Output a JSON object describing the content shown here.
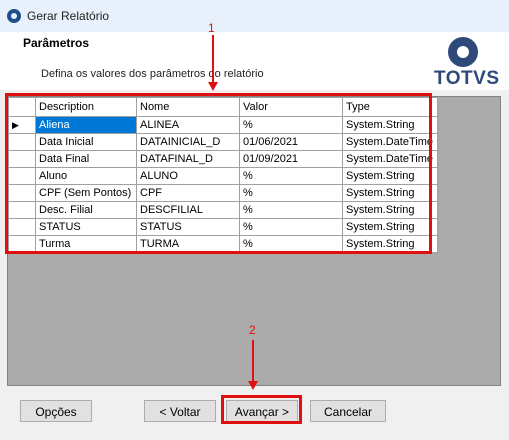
{
  "window": {
    "title": "Gerar Relatório"
  },
  "header": {
    "title": "Parâmetros",
    "description": "Defina os valores dos parâmetros do relatório",
    "logo_text": "TOTVS"
  },
  "grid": {
    "columns": [
      "Description",
      "Nome",
      "Valor",
      "Type"
    ],
    "current_row_marker": "▶",
    "rows": [
      [
        "Aliena",
        "ALINEA",
        "%",
        "System.String"
      ],
      [
        "Data Inicial",
        "DATAINICIAL_D",
        "01/06/2021",
        "System.DateTime"
      ],
      [
        "Data Final",
        "DATAFINAL_D",
        "01/09/2021",
        "System.DateTime"
      ],
      [
        "Aluno",
        "ALUNO",
        "%",
        "System.String"
      ],
      [
        "CPF (Sem Pontos)",
        "CPF",
        "%",
        "System.String"
      ],
      [
        "Desc. Filial",
        "DESCFILIAL",
        "%",
        "System.String"
      ],
      [
        "STATUS",
        "STATUS",
        "%",
        "System.String"
      ],
      [
        "Turma",
        "TURMA",
        "%",
        "System.String"
      ]
    ]
  },
  "buttons": {
    "options": "Opções",
    "back": "< Voltar",
    "next": "Avançar >",
    "cancel": "Cancelar"
  },
  "annotations": {
    "marker_1": "1",
    "marker_2": "2"
  },
  "colors": {
    "highlight": "#e01010",
    "selection": "#0078d7",
    "brand": "#2d4a7a"
  }
}
